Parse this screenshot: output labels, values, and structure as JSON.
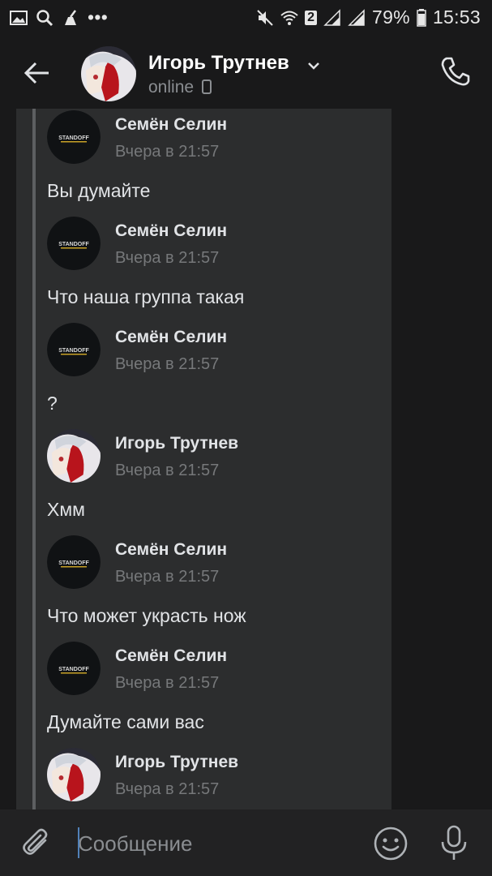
{
  "status_bar": {
    "wifi_badge": "2",
    "battery": "79%",
    "time": "15:53",
    "more": "•••"
  },
  "header": {
    "contact_name": "Игорь Трутнев",
    "status": "online"
  },
  "messages": [
    {
      "author": "Семён Селин",
      "time": "Вчера в 21:57",
      "avatar": "standoff-logo",
      "text": "Вы думайте"
    },
    {
      "author": "Семён Селин",
      "time": "Вчера в 21:57",
      "avatar": "standoff-logo",
      "text": "Что наша группа такая"
    },
    {
      "author": "Семён Селин",
      "time": "Вчера в 21:57",
      "avatar": "standoff-logo",
      "text": "?"
    },
    {
      "author": "Игорь Трутнев",
      "time": "Вчера в 21:57",
      "avatar": "anime-avatar",
      "text": "Хмм"
    },
    {
      "author": "Семён Селин",
      "time": "Вчера в 21:57",
      "avatar": "standoff-logo",
      "text": "Что может украсть нож"
    },
    {
      "author": "Семён Селин",
      "time": "Вчера в 21:57",
      "avatar": "standoff-logo",
      "text": "Думайте сами вас"
    },
    {
      "author": "Игорь Трутнев",
      "time": "Вчера в 21:57",
      "avatar": "anime-avatar",
      "text": ""
    }
  ],
  "avatar_logo_text": "STANDOFF",
  "composer": {
    "placeholder": "Сообщение"
  },
  "colors": {
    "background": "#19191a",
    "bubble": "#2c2d2e",
    "accent": "#5181b8"
  }
}
